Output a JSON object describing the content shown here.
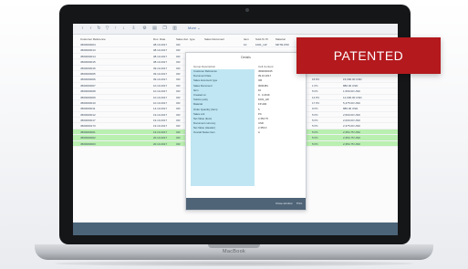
{
  "device": {
    "brand_label": "MacBook"
  },
  "badge": {
    "label": "PATENTED",
    "color": "#b3191d"
  },
  "toolbar": {
    "icons": [
      "back-icon",
      "forward-icon",
      "refresh-icon",
      "filter-icon",
      "sort-icon",
      "sort-desc-icon",
      "export-icon",
      "settings-icon",
      "print-icon",
      "copy-icon",
      "chart-icon"
    ],
    "more_label": "More ⌄"
  },
  "table": {
    "columns": [
      "Customer Reference",
      "Doc. Date",
      "Sales doc. type",
      "Sales Document",
      "Item",
      "Sold-To Pt",
      "Material"
    ],
    "first_row_tail": [
      "10",
      "1001_LW",
      "MFTR-P00"
    ],
    "rows": [
      {
        "ref": "4500000004",
        "date": "08.10.2017",
        "type": "OR",
        "qty": "",
        "amt": ""
      },
      {
        "ref": "4500000013",
        "date": "08.10.2017",
        "type": "OR",
        "qty": "",
        "amt": ""
      },
      {
        "ref": "4500000014",
        "date": "08.10.2017",
        "type": "OR",
        "qty": "",
        "amt": ""
      },
      {
        "ref": "4500000015",
        "date": "08.10.2017",
        "type": "OR",
        "qty": "",
        "amt": ""
      },
      {
        "ref": "4500000016",
        "date": "09.10.2017",
        "type": "OR",
        "qty": "",
        "amt": ""
      },
      {
        "ref": "4500000005",
        "date": "09.10.2017",
        "type": "OR",
        "qty": "",
        "amt": ""
      },
      {
        "ref": "4500000006",
        "date": "09.10.2017",
        "type": "OR",
        "qty": "15  PC",
        "amt": "15,000.00  USD"
      },
      {
        "ref": "4500000007",
        "date": "10.10.2017",
        "type": "OR",
        "qty": "1  PC",
        "amt": "880.00  USD"
      },
      {
        "ref": "4500000008",
        "date": "10.10.2017",
        "type": "OR",
        "qty": "5  PC",
        "amt": "1,500.00  USD"
      },
      {
        "ref": "4500000009",
        "date": "10.10.2017",
        "type": "OR",
        "qty": "12  PC",
        "amt": "12,000.00  USD"
      },
      {
        "ref": "4500000010",
        "date": "10.10.2017",
        "type": "OR",
        "qty": "17  PC",
        "amt": "5,475.00  USD"
      },
      {
        "ref": "4500000011",
        "date": "14.10.2017",
        "type": "OR",
        "qty": "9  PC",
        "amt": "880.00  USD"
      },
      {
        "ref": "4500000012",
        "date": "19.10.2017",
        "type": "OR",
        "qty": "5  PC",
        "amt": "2,500.00  USD"
      },
      {
        "ref": "4500000017",
        "date": "19.10.2017",
        "type": "OR",
        "qty": "5  PC",
        "amt": "2,000.00  USD"
      },
      {
        "ref": "4500000173",
        "date": "19.10.2017",
        "type": "OR",
        "qty": "5  PC",
        "amt": "2,375.00  USD"
      },
      {
        "ref": "4500000001",
        "date": "19.10.2017",
        "type": "OR",
        "qty": "5  PC",
        "amt": "2,354.75  USD"
      },
      {
        "ref": "4500000002",
        "date": "20.10.2017",
        "type": "OR",
        "qty": "5  PC",
        "amt": "2,354.75  USD"
      },
      {
        "ref": "4500000003",
        "date": "20.10.2017",
        "type": "OR",
        "qty": "5  PC",
        "amt": "2,354.75  USD"
      }
    ],
    "highlighted_rows": [
      15,
      16,
      17
    ],
    "highlight_color": "#b9efb0"
  },
  "dialog": {
    "title": "Details",
    "col_field": "Group Description",
    "col_value": "Cell Content",
    "fields": [
      {
        "label": "Customer Reference",
        "value": "4500000015"
      },
      {
        "label": "Document Date",
        "value": "09.10.2017"
      },
      {
        "label": "Sales document type",
        "value": "OR"
      },
      {
        "label": "Sales Document",
        "value": "0000481"
      },
      {
        "label": "Item",
        "value": "10"
      },
      {
        "label": "Created on",
        "value": "9 . 3.2019"
      },
      {
        "label": "Sold-to party",
        "value": "1001_LW"
      },
      {
        "label": "Material",
        "value": "FP-200"
      },
      {
        "label": "Order Quantity (Item)",
        "value": "5"
      },
      {
        "label": "Sales unit",
        "value": "PC"
      },
      {
        "label": "Net Value (Item)",
        "value": "2,354.75"
      },
      {
        "label": "Document currency",
        "value": "USD"
      },
      {
        "label": "Net Value (Header)",
        "value": "2,353.0"
      },
      {
        "label": "Overall Status Item",
        "value": "A"
      }
    ],
    "footer": {
      "secondary_label": "Close window",
      "primary_label": "Print"
    }
  }
}
